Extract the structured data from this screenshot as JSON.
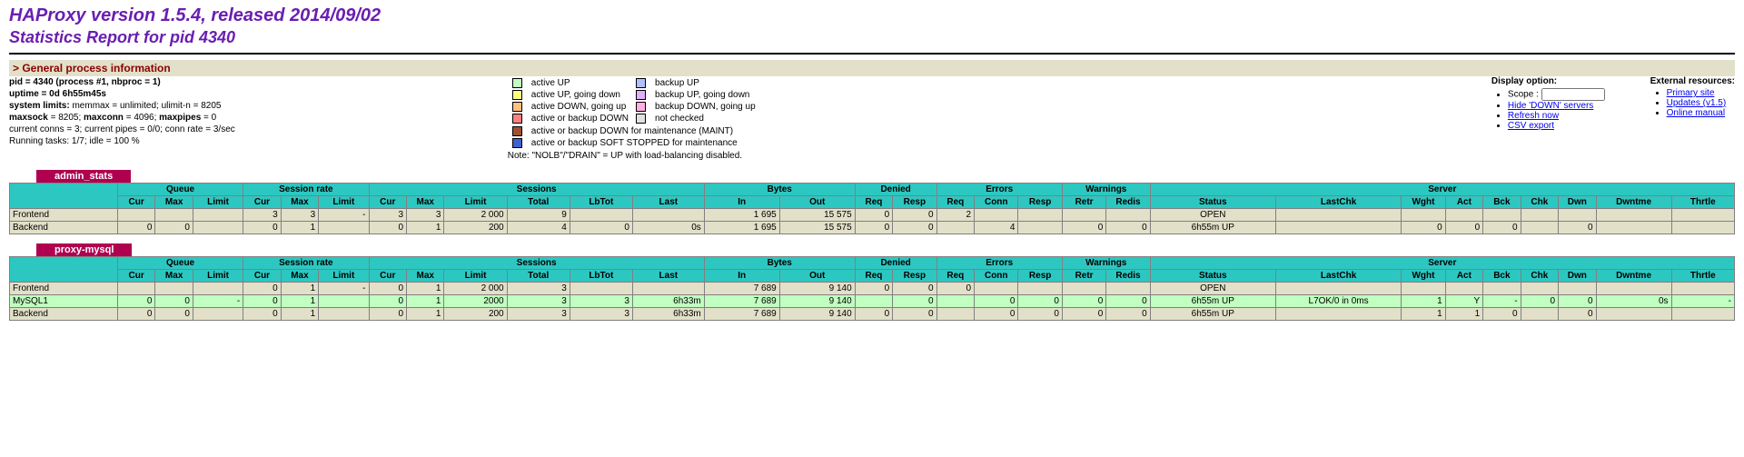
{
  "title": "HAProxy version 1.5.4, released 2014/09/02",
  "subtitle": "Statistics Report for pid 4340",
  "gpi_title": "> General process information",
  "proc": {
    "l1": "pid = 4340 (process #1, nbproc = 1)",
    "l2": "uptime = 0d 6h55m45s",
    "l3": "system limits: memmax = unlimited; ulimit-n = 8205",
    "l4": "maxsock = 8205; maxconn = 4096; maxpipes = 0",
    "l5": "current conns = 3; current pipes = 0/0; conn rate = 3/sec",
    "l6": "Running tasks: 1/7; idle = 100 %"
  },
  "legend": {
    "l": [
      "active UP",
      "active UP, going down",
      "active DOWN, going up",
      "active or backup DOWN",
      "active or backup DOWN for maintenance (MAINT)",
      "active or backup SOFT STOPPED for maintenance"
    ],
    "r": [
      "backup UP",
      "backup UP, going down",
      "backup DOWN, going up",
      "not checked"
    ],
    "note": "Note: \"NOLB\"/\"DRAIN\" = UP with load-balancing disabled."
  },
  "display": {
    "title": "Display option:",
    "scope": "Scope :",
    "hide": "Hide 'DOWN' servers",
    "refresh": "Refresh now",
    "csv": "CSV export"
  },
  "ext": {
    "title": "External resources:",
    "primary": "Primary site",
    "updates": "Updates (v1.5)",
    "manual": "Online manual"
  },
  "h": {
    "queue": "Queue",
    "srate": "Session rate",
    "sess": "Sessions",
    "bytes": "Bytes",
    "denied": "Denied",
    "errors": "Errors",
    "warn": "Warnings",
    "server": "Server",
    "cur": "Cur",
    "max": "Max",
    "limit": "Limit",
    "total": "Total",
    "lbtot": "LbTot",
    "last": "Last",
    "in": "In",
    "out": "Out",
    "req": "Req",
    "resp": "Resp",
    "conn": "Conn",
    "retr": "Retr",
    "redis": "Redis",
    "status": "Status",
    "lastchk": "LastChk",
    "wght": "Wght",
    "act": "Act",
    "bck": "Bck",
    "chk": "Chk",
    "dwn": "Dwn",
    "dwntme": "Dwntme",
    "thrtle": "Thrtle"
  },
  "proxies": [
    {
      "name": "admin_stats",
      "rows": [
        {
          "cls": "fe",
          "name": "Frontend",
          "q": [
            "",
            "",
            ""
          ],
          "sr": [
            "3",
            "3",
            "-"
          ],
          "s": [
            "3",
            "3",
            "2 000",
            "9",
            "",
            ""
          ],
          "b": [
            "1 695",
            "15 575"
          ],
          "d": [
            "0",
            "0"
          ],
          "e": [
            "2",
            "",
            ""
          ],
          "w": [
            "",
            ""
          ],
          "sv": [
            "OPEN",
            "",
            "",
            "",
            "",
            "",
            "",
            ""
          ]
        },
        {
          "cls": "be",
          "name": "Backend",
          "q": [
            "0",
            "0",
            ""
          ],
          "sr": [
            "0",
            "1",
            ""
          ],
          "s": [
            "0",
            "1",
            "200",
            "4",
            "0",
            "0s"
          ],
          "b": [
            "1 695",
            "15 575"
          ],
          "d": [
            "0",
            "0"
          ],
          "e": [
            "",
            "4",
            ""
          ],
          "w": [
            "0",
            "0"
          ],
          "sv": [
            "6h55m UP",
            "",
            "0",
            "0",
            "0",
            "",
            "0",
            ""
          ]
        }
      ]
    },
    {
      "name": "proxy-mysql",
      "rows": [
        {
          "cls": "fe",
          "name": "Frontend",
          "q": [
            "",
            "",
            ""
          ],
          "sr": [
            "0",
            "1",
            "-"
          ],
          "s": [
            "0",
            "1",
            "2 000",
            "3",
            "",
            ""
          ],
          "b": [
            "7 689",
            "9 140"
          ],
          "d": [
            "0",
            "0"
          ],
          "e": [
            "0",
            "",
            ""
          ],
          "w": [
            "",
            ""
          ],
          "sv": [
            "OPEN",
            "",
            "",
            "",
            "",
            "",
            "",
            ""
          ]
        },
        {
          "cls": "srv",
          "name": "MySQL1",
          "q": [
            "0",
            "0",
            "-"
          ],
          "sr": [
            "0",
            "1",
            ""
          ],
          "s": [
            "0",
            "1",
            "2000",
            "3",
            "3",
            "6h33m"
          ],
          "b": [
            "7 689",
            "9 140"
          ],
          "d": [
            "",
            "0"
          ],
          "e": [
            "",
            "0",
            "0"
          ],
          "w": [
            "0",
            "0"
          ],
          "sv": [
            "6h55m UP",
            "L7OK/0 in 0ms",
            "1",
            "Y",
            "-",
            "0",
            "0",
            "0s",
            "-"
          ]
        },
        {
          "cls": "be",
          "name": "Backend",
          "q": [
            "0",
            "0",
            ""
          ],
          "sr": [
            "0",
            "1",
            ""
          ],
          "s": [
            "0",
            "1",
            "200",
            "3",
            "3",
            "6h33m"
          ],
          "b": [
            "7 689",
            "9 140"
          ],
          "d": [
            "0",
            "0"
          ],
          "e": [
            "",
            "0",
            "0"
          ],
          "w": [
            "0",
            "0"
          ],
          "sv": [
            "6h55m UP",
            "",
            "1",
            "1",
            "0",
            "",
            "0",
            ""
          ]
        }
      ]
    }
  ],
  "colors": {
    "aup": "#c0ffc0",
    "augd": "#ffff80",
    "adgu": "#ffc080",
    "down": "#ff8080",
    "maint": "#a05030",
    "soft": "#4060d0",
    "bup": "#b0c0ff",
    "bugd": "#e0b0ff",
    "bdgu": "#ffb0e0",
    "nc": "#e0e0e0"
  }
}
